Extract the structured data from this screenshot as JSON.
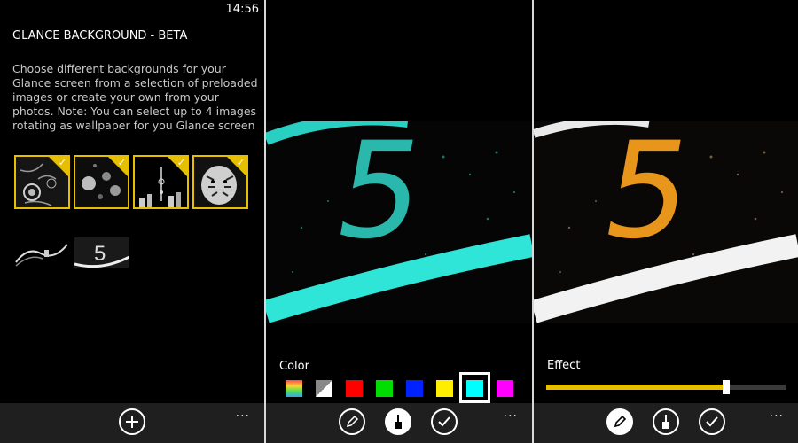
{
  "status": {
    "time": "14:56"
  },
  "glance": {
    "title": "GLANCE BACKGROUND - BETA",
    "description": "Choose different backgrounds for your Glance screen from a selection of preloaded images or create your own from your photos. Note: You can select up to 4 images rotating as wallpaper for you Glance screen",
    "selected_thumbnails": [
      "flowers",
      "lanterns",
      "city-skyline",
      "tiger"
    ],
    "unselected_thumbnails": [
      "great-wall",
      "number-five"
    ]
  },
  "color_editor": {
    "label": "Color",
    "big_digit": "5",
    "accent": "#2ee5d8",
    "swatches": [
      {
        "name": "rainbow",
        "color": "#rainbow"
      },
      {
        "name": "white-black",
        "color": "#ffffff"
      },
      {
        "name": "red",
        "color": "#ff0000"
      },
      {
        "name": "green",
        "color": "#00dd00"
      },
      {
        "name": "blue",
        "color": "#0022ff"
      },
      {
        "name": "yellow",
        "color": "#ffee00"
      },
      {
        "name": "cyan",
        "color": "#00ffff",
        "selected": true
      },
      {
        "name": "magenta",
        "color": "#ff00ff"
      }
    ]
  },
  "effect_editor": {
    "label": "Effect",
    "big_digit": "5",
    "accent": "#e8951c",
    "slider_value": 0.75,
    "slider_color": "#e6c000"
  },
  "appbar": {
    "more": "..."
  }
}
